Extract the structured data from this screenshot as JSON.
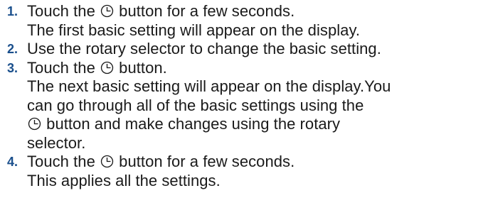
{
  "steps": [
    {
      "number": "1.",
      "lines": [
        {
          "before": "Touch the ",
          "icon": "clock-icon",
          "after": " button for a few seconds."
        },
        {
          "text": "The first basic setting will appear on the display."
        }
      ]
    },
    {
      "number": "2.",
      "lines": [
        {
          "text": "Use the rotary selector to change the basic setting."
        }
      ]
    },
    {
      "number": "3.",
      "lines": [
        {
          "before": "Touch the ",
          "icon": "clock-icon",
          "after": " button."
        },
        {
          "text": "The next basic setting will appear on the display.You"
        },
        {
          "text": "can go through all of the basic settings using the"
        },
        {
          "icon": "clock-icon",
          "after": " button and make changes using the rotary"
        },
        {
          "text": "selector."
        }
      ]
    },
    {
      "number": "4.",
      "lines": [
        {
          "before": "Touch the ",
          "icon": "clock-icon",
          "after": " button for a few seconds."
        },
        {
          "text": "This applies all the settings."
        }
      ]
    }
  ],
  "colors": {
    "step_number": "#1a4f8c",
    "text": "#1a1a1a"
  }
}
